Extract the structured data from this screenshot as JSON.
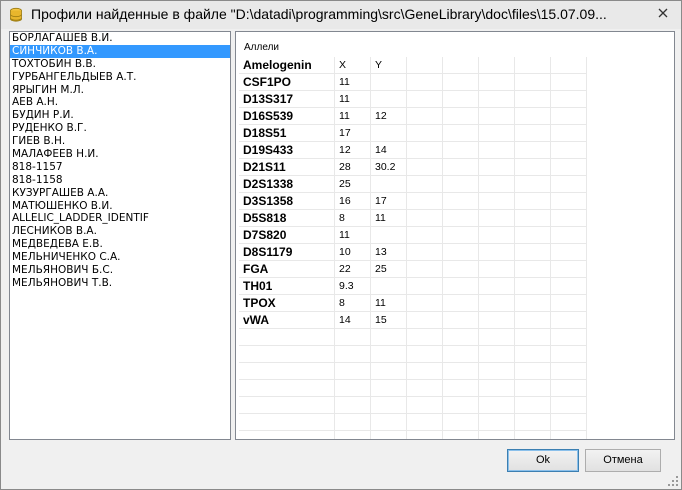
{
  "window": {
    "title": "Профили найденные в файле \"D:\\datadi\\programming\\src\\GeneLibrary\\doc\\files\\15.07.09...",
    "close_icon": "close-icon",
    "app_icon": "database-icon"
  },
  "profiles": {
    "selected_index": 1,
    "items": [
      "БОРЛАГАШЕВ В.И.",
      "СИНЧИКОВ В.А.",
      "ТОХТОБИН В.В.",
      "ГУРБАНГЕЛЬДЫЕВ А.Т.",
      "ЯРЫГИН М.Л.",
      "АЕВ А.Н.",
      "БУДИН Р.И.",
      "РУДЕНКО В.Г.",
      "ГИЕВ В.Н.",
      "МАЛАФЕЕВ Н.И.",
      "818-1157",
      "818-1158",
      "КУЗУРГАШЕВ А.А.",
      "МАТЮШЕНКО В.И.",
      "ALLELIC_LADDER_IDENTIF",
      "ЛЕСНИКОВ В.А.",
      "МЕДВЕДЕВА Е.В.",
      "МЕЛЬНИЧЕНКО С.А.",
      "МЕЛЬЯНОВИЧ Б.С.",
      "МЕЛЬЯНОВИЧ Т.В."
    ]
  },
  "alleles": {
    "caption": "Аллели",
    "rows": [
      [
        "Amelogenin",
        "X",
        "Y"
      ],
      [
        "CSF1PO",
        "11",
        ""
      ],
      [
        "D13S317",
        "11",
        ""
      ],
      [
        "D16S539",
        "11",
        "12"
      ],
      [
        "D18S51",
        "17",
        ""
      ],
      [
        "D19S433",
        "12",
        "14"
      ],
      [
        "D21S11",
        "28",
        "30.2"
      ],
      [
        "D2S1338",
        "25",
        ""
      ],
      [
        "D3S1358",
        "16",
        "17"
      ],
      [
        "D5S818",
        "8",
        "11"
      ],
      [
        "D7S820",
        "11",
        ""
      ],
      [
        "D8S1179",
        "10",
        "13"
      ],
      [
        "FGA",
        "22",
        "25"
      ],
      [
        "TH01",
        "9.3",
        ""
      ],
      [
        "TPOX",
        "8",
        "11"
      ],
      [
        "vWA",
        "14",
        "15"
      ]
    ]
  },
  "buttons": {
    "ok": "Ok",
    "cancel": "Отмена"
  }
}
